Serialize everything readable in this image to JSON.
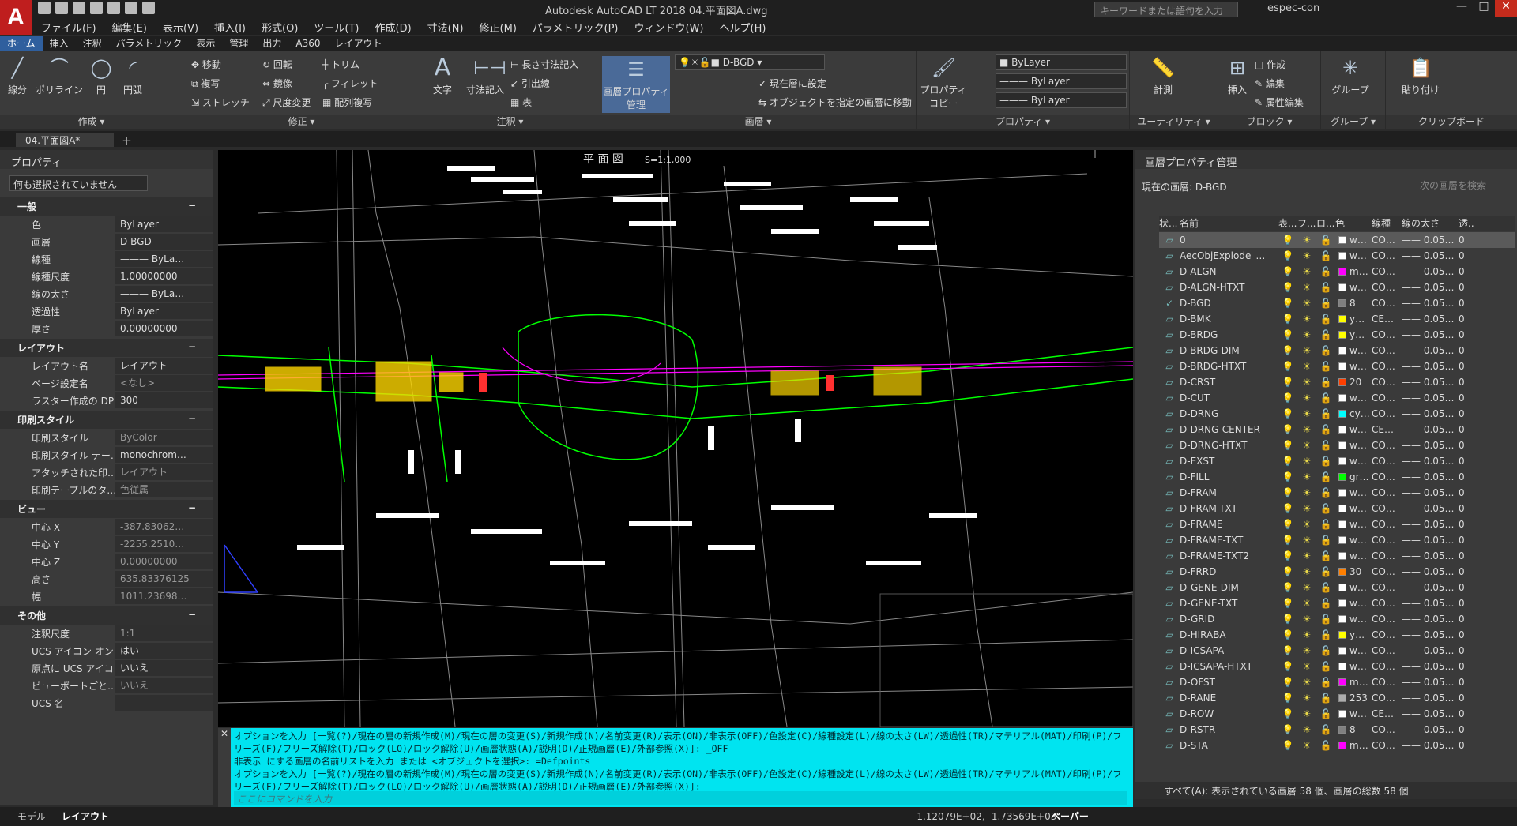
{
  "app": {
    "title": "Autodesk AutoCAD LT 2018    04.平面図A.dwg",
    "logo_text": "A",
    "logo_sub": "LT",
    "search_placeholder": "キーワードまたは語句を入力",
    "user": "espec-con"
  },
  "menus": [
    "ファイル(F)",
    "編集(E)",
    "表示(V)",
    "挿入(I)",
    "形式(O)",
    "ツール(T)",
    "作成(D)",
    "寸法(N)",
    "修正(M)",
    "パラメトリック(P)",
    "ウィンドウ(W)",
    "ヘルプ(H)"
  ],
  "ribbon_tabs": [
    "ホーム",
    "挿入",
    "注釈",
    "パラメトリック",
    "表示",
    "管理",
    "出力",
    "A360",
    "レイアウト"
  ],
  "ribbon": {
    "draw": {
      "title": "作成 ▾",
      "line": "線分",
      "polyline": "ポリライン",
      "circle": "円",
      "arc": "円弧"
    },
    "modify": {
      "title": "修正 ▾",
      "move": "移動",
      "rotate": "回転",
      "trim": "トリム",
      "copy": "複写",
      "mirror": "鏡像",
      "fillet": "フィレット",
      "stretch": "ストレッチ",
      "scale": "尺度変更",
      "array": "配列複写"
    },
    "annotation": {
      "title": "注釈 ▾",
      "text": "文字",
      "dim": "寸法記入",
      "lindim": "長さ寸法記入",
      "leader": "引出線",
      "table": "表"
    },
    "layers": {
      "title": "画層 ▾",
      "manager": "画層プロパティ管理",
      "current": "D-BGD",
      "setcur": "現在層に設定",
      "moveto": "オブジェクトを指定の画層に移動"
    },
    "properties": {
      "title": "プロパティ ▾",
      "copy": "プロパティコピー",
      "color": "ByLayer",
      "ltype": "ByLayer",
      "lweight": "ByLayer"
    },
    "utilities": {
      "title": "ユーティリティ ▾",
      "measure": "計測"
    },
    "block": {
      "title": "ブロック ▾",
      "insert": "挿入",
      "create": "作成",
      "edit": "編集",
      "attedit": "属性編集"
    },
    "groups": {
      "title": "グループ ▾",
      "group": "グループ"
    },
    "clipboard": {
      "title": "クリップボード",
      "paste": "貼り付け"
    }
  },
  "doc_tab": "04.平面図A*",
  "properties": {
    "title": "プロパティ",
    "selection": "何も選択されていません",
    "sections": [
      {
        "name": "一般",
        "rows": [
          [
            "色",
            "ByLayer",
            false
          ],
          [
            "画層",
            "D-BGD",
            false
          ],
          [
            "線種",
            "——— ByLa…",
            false
          ],
          [
            "線種尺度",
            "1.00000000",
            false
          ],
          [
            "線の太さ",
            "——— ByLa…",
            false
          ],
          [
            "透過性",
            "ByLayer",
            false
          ],
          [
            "厚さ",
            "0.00000000",
            false
          ]
        ]
      },
      {
        "name": "レイアウト",
        "rows": [
          [
            "レイアウト名",
            "レイアウト",
            false
          ],
          [
            "ページ設定名",
            "<なし>",
            true
          ],
          [
            "ラスター作成の DPI",
            "300",
            false
          ]
        ]
      },
      {
        "name": "印刷スタイル",
        "rows": [
          [
            "印刷スタイル",
            "ByColor",
            true
          ],
          [
            "印刷スタイル テー…",
            "monochrom…",
            false
          ],
          [
            "アタッチされた印…",
            "レイアウト",
            true
          ],
          [
            "印刷テーブルのタ…",
            "色従属",
            true
          ]
        ]
      },
      {
        "name": "ビュー",
        "rows": [
          [
            "中心 X",
            "-387.83062…",
            true
          ],
          [
            "中心 Y",
            "-2255.2510…",
            true
          ],
          [
            "中心 Z",
            "0.00000000",
            true
          ],
          [
            "高さ",
            "635.83376125",
            true
          ],
          [
            "幅",
            "1011.23698…",
            true
          ]
        ]
      },
      {
        "name": "その他",
        "rows": [
          [
            "注釈尺度",
            "1:1",
            true
          ],
          [
            "UCS アイコン オン",
            "はい",
            false
          ],
          [
            "原点に UCS アイコン",
            "いいえ",
            false
          ],
          [
            "ビューポートごと…",
            "いいえ",
            true
          ],
          [
            "UCS 名",
            "",
            false
          ]
        ]
      }
    ]
  },
  "drawing": {
    "title": "平 面 図",
    "scale": "S=1:1,000"
  },
  "command": {
    "history": [
      "オプションを入力 [一覧(?)/現在の層の新規作成(M)/現在の層の変更(S)/新規作成(N)/名前変更(R)/表示(ON)/非表示(OFF)/色設定(C)/線種設定(L)/線の太さ(LW)/透過性(TR)/マテリアル(MAT)/印刷(P)/フリーズ(F)/フリーズ解除(T)/ロック(LO)/ロック解除(U)/画層状態(A)/説明(D)/正規画層(E)/外部参照(X)]: _OFF",
      "非表示 にする画層の名前リストを入力 または <オブジェクトを選択>: =Defpoints",
      "オプションを入力 [一覧(?)/現在の層の新規作成(M)/現在の層の変更(S)/新規作成(N)/名前変更(R)/表示(ON)/非表示(OFF)/色設定(C)/線種設定(L)/線の太さ(LW)/透過性(TR)/マテリアル(MAT)/印刷(P)/フリーズ(F)/フリーズ解除(T)/ロック(LO)/ロック解除(U)/画層状態(A)/説明(D)/正規画層(E)/外部参照(X)]:"
    ],
    "placeholder": "ここにコマンドを入力"
  },
  "layers": {
    "title": "画層プロパティ管理",
    "current": "現在の画層: D-BGD",
    "search": "次の画層を検索",
    "headers": [
      "状...",
      "名前",
      "表...",
      "フ...",
      "ロ...",
      "色",
      "線種",
      "線の太さ",
      "透..."
    ],
    "rows": [
      [
        "0",
        "w…",
        "#ffffff",
        "CO…"
      ],
      [
        "AecObjExplode_…",
        "w…",
        "#ffffff",
        "CO…"
      ],
      [
        "D-ALGN",
        "m…",
        "#ff00ff",
        "CO…"
      ],
      [
        "D-ALGN-HTXT",
        "w…",
        "#ffffff",
        "CO…"
      ],
      [
        "D-BGD",
        "8",
        "#808080",
        "CO…"
      ],
      [
        "D-BMK",
        "y…",
        "#ffff00",
        "CE…"
      ],
      [
        "D-BRDG",
        "y…",
        "#ffff00",
        "CO…"
      ],
      [
        "D-BRDG-DIM",
        "w…",
        "#ffffff",
        "CO…"
      ],
      [
        "D-BRDG-HTXT",
        "w…",
        "#ffffff",
        "CO…"
      ],
      [
        "D-CRST",
        "20",
        "#ff3f00",
        "CO…"
      ],
      [
        "D-CUT",
        "w…",
        "#ffffff",
        "CO…"
      ],
      [
        "D-DRNG",
        "cy…",
        "#00ffff",
        "CO…"
      ],
      [
        "D-DRNG-CENTER",
        "w…",
        "#ffffff",
        "CE…"
      ],
      [
        "D-DRNG-HTXT",
        "w…",
        "#ffffff",
        "CO…"
      ],
      [
        "D-EXST",
        "w…",
        "#ffffff",
        "CO…"
      ],
      [
        "D-FILL",
        "gr…",
        "#00ff00",
        "CO…"
      ],
      [
        "D-FRAM",
        "w…",
        "#ffffff",
        "CO…"
      ],
      [
        "D-FRAM-TXT",
        "w…",
        "#ffffff",
        "CO…"
      ],
      [
        "D-FRAME",
        "w…",
        "#ffffff",
        "CO…"
      ],
      [
        "D-FRAME-TXT",
        "w…",
        "#ffffff",
        "CO…"
      ],
      [
        "D-FRAME-TXT2",
        "w…",
        "#ffffff",
        "CO…"
      ],
      [
        "D-FRRD",
        "30",
        "#ff7f00",
        "CO…"
      ],
      [
        "D-GENE-DIM",
        "w…",
        "#ffffff",
        "CO…"
      ],
      [
        "D-GENE-TXT",
        "w…",
        "#ffffff",
        "CO…"
      ],
      [
        "D-GRID",
        "w…",
        "#ffffff",
        "CO…"
      ],
      [
        "D-HIRABA",
        "y…",
        "#ffff00",
        "CO…"
      ],
      [
        "D-ICSAPA",
        "w…",
        "#ffffff",
        "CO…"
      ],
      [
        "D-ICSAPA-HTXT",
        "w…",
        "#ffffff",
        "CO…"
      ],
      [
        "D-OFST",
        "m…",
        "#ff00ff",
        "CO…"
      ],
      [
        "D-RANE",
        "253",
        "#adadad",
        "CO…"
      ],
      [
        "D-ROW",
        "w…",
        "#ffffff",
        "CE…"
      ],
      [
        "D-RSTR",
        "8",
        "#808080",
        "CO…"
      ],
      [
        "D-STA",
        "m…",
        "#ff00ff",
        "CO…"
      ]
    ],
    "lweight": "—— 0.05…",
    "trans": "0",
    "status": "すべて(A): 表示されている画層 58 個、画層の総数 58 個"
  },
  "statusbar": {
    "model": "モデル",
    "layout": "レイアウト",
    "coords": "-1.12079E+02, -1.73569E+03",
    "space": "ペーパー"
  }
}
